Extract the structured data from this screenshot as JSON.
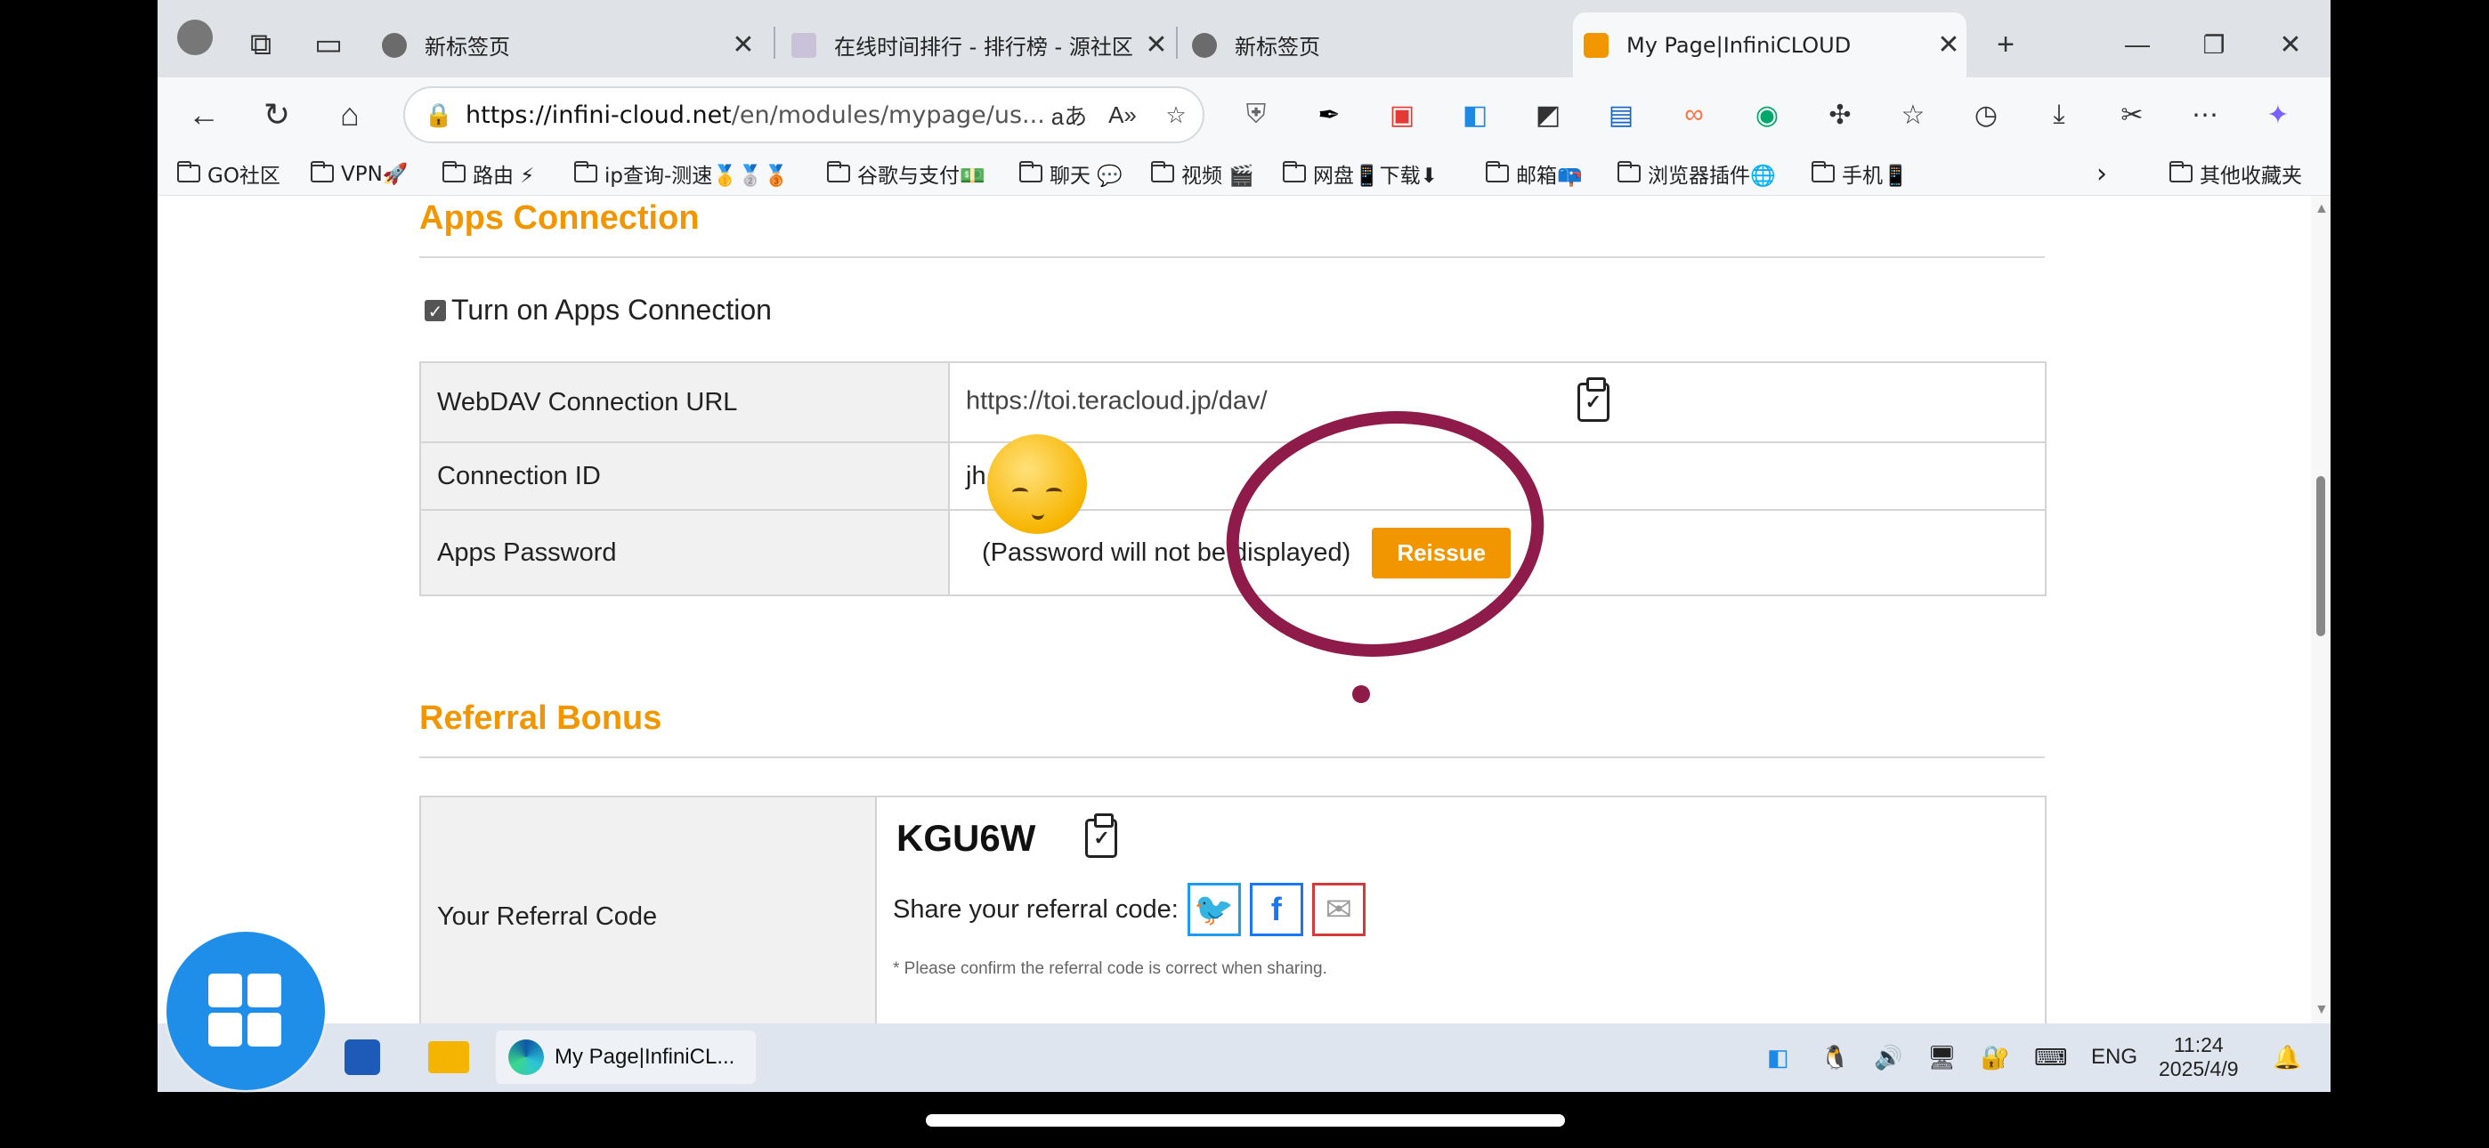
{
  "tabs": [
    {
      "title": "新标签页",
      "active": false
    },
    {
      "title": "在线时间排行 - 排行榜 - 源社区 -",
      "active": false
    },
    {
      "title": "新标签页",
      "active": false
    },
    {
      "title": "My Page|InfiniCLOUD",
      "active": true
    }
  ],
  "tab_controls": {
    "new_tab": "+",
    "minimize": "—",
    "restore": "❐",
    "close": "✕"
  },
  "address": {
    "host": "https://infini-cloud.net",
    "path": "/en/modules/mypage/us..."
  },
  "bookmarks": [
    {
      "label": "GO社区"
    },
    {
      "label": "VPN🚀"
    },
    {
      "label": "路由 ⚡"
    },
    {
      "label": "ip查询-测速🥇🥈🥉"
    },
    {
      "label": "谷歌与支付💵"
    },
    {
      "label": "聊天 💬"
    },
    {
      "label": "视频 🎬"
    },
    {
      "label": "网盘📱下载⬇"
    },
    {
      "label": "邮箱📪"
    },
    {
      "label": "浏览器插件🌐"
    },
    {
      "label": "手机📱"
    },
    {
      "label": "其他收藏夹"
    }
  ],
  "apps_connection": {
    "heading": "Apps Connection",
    "toggle_label": "Turn on Apps Connection",
    "rows": [
      {
        "label": "WebDAV Connection URL",
        "value": "https://toi.teracloud.jp/dav/"
      },
      {
        "label": "Connection ID",
        "value": "jh"
      },
      {
        "label": "Apps Password",
        "value": "(Password will not be displayed)"
      }
    ],
    "reissue_label": "Reissue"
  },
  "referral": {
    "heading": "Referral Bonus",
    "row_label": "Your Referral Code",
    "code": "KGU6W",
    "share_label": "Share your referral code:",
    "note": "* Please confirm the referral code is correct when sharing."
  },
  "taskbar": {
    "app_title": "My Page|InfiniCL...",
    "lang": "ENG",
    "time": "11:24",
    "date": "2025/4/9"
  },
  "colors": {
    "accent": "#f29600",
    "annotation": "#8e1b4a",
    "twitter": "#1d9bf0",
    "facebook": "#1877f2",
    "mail": "#d33b3b"
  }
}
